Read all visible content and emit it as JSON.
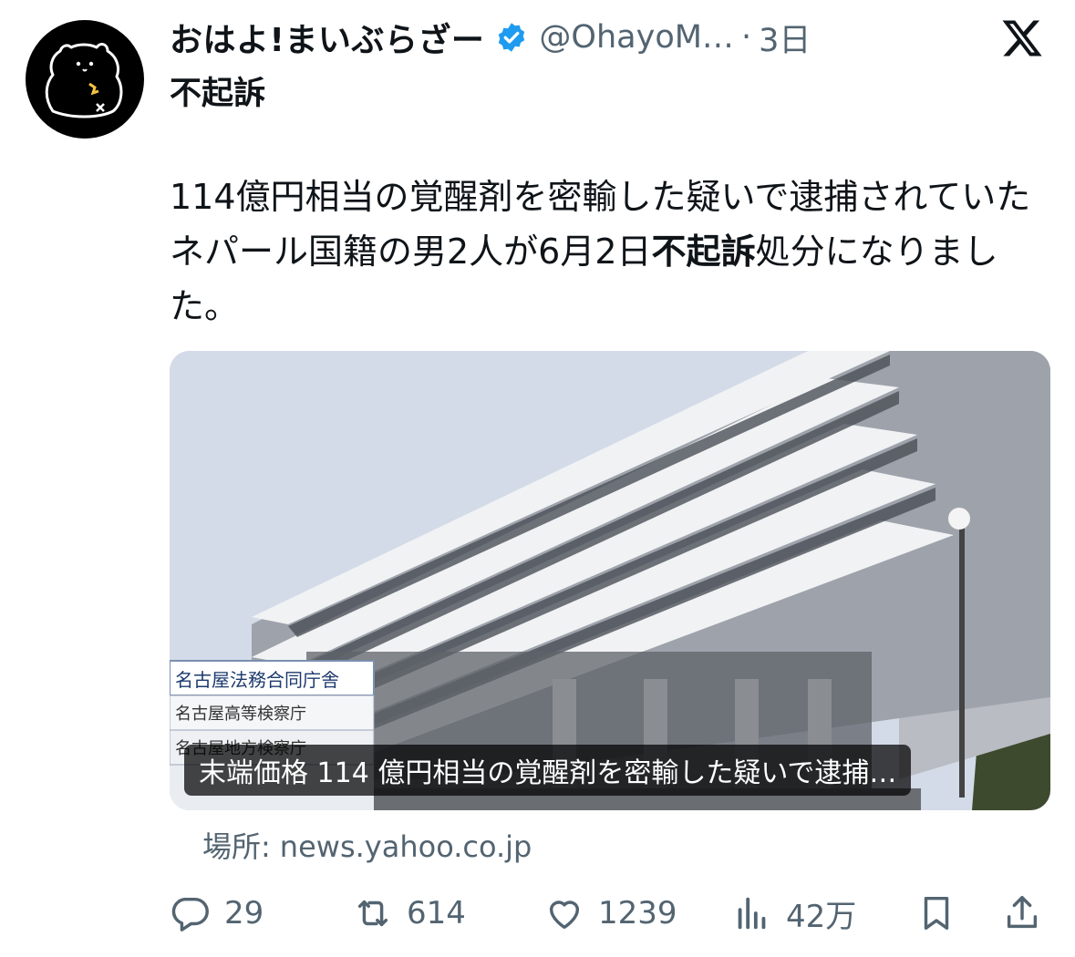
{
  "tweet": {
    "display_name": "おはよ!まいぶらざー",
    "handle": "@OhayoM…",
    "separator": "·",
    "time": "3日",
    "subject": "不起訴",
    "body_part1": "114億円相当の覚醒剤を密輸した疑いで逮捕されていたネパール国籍の男2人が6月2日",
    "body_bold": "不起訴",
    "body_part2": "処分になりました。"
  },
  "card": {
    "caption": "末端価格 114 億円相当の覚醒剤を密輸した疑いで逮捕…",
    "source_label": "場所:",
    "source_domain": "news.yahoo.co.jp",
    "sign_text_1": "名古屋法務合同庁舎",
    "sign_text_2": "名古屋高等検察庁",
    "sign_text_3": "名古屋地方検察庁"
  },
  "actions": {
    "replies": "29",
    "retweets": "614",
    "likes": "1239",
    "views": "42万"
  },
  "icons": {
    "verified": "verified-badge-icon",
    "logo": "x-logo-icon",
    "reply": "reply-icon",
    "retweet": "retweet-icon",
    "like": "heart-icon",
    "views": "views-icon",
    "bookmark": "bookmark-icon",
    "share": "share-icon"
  },
  "colors": {
    "verified_blue": "#1d9bf0",
    "text": "#0f1419",
    "secondary": "#536471"
  }
}
